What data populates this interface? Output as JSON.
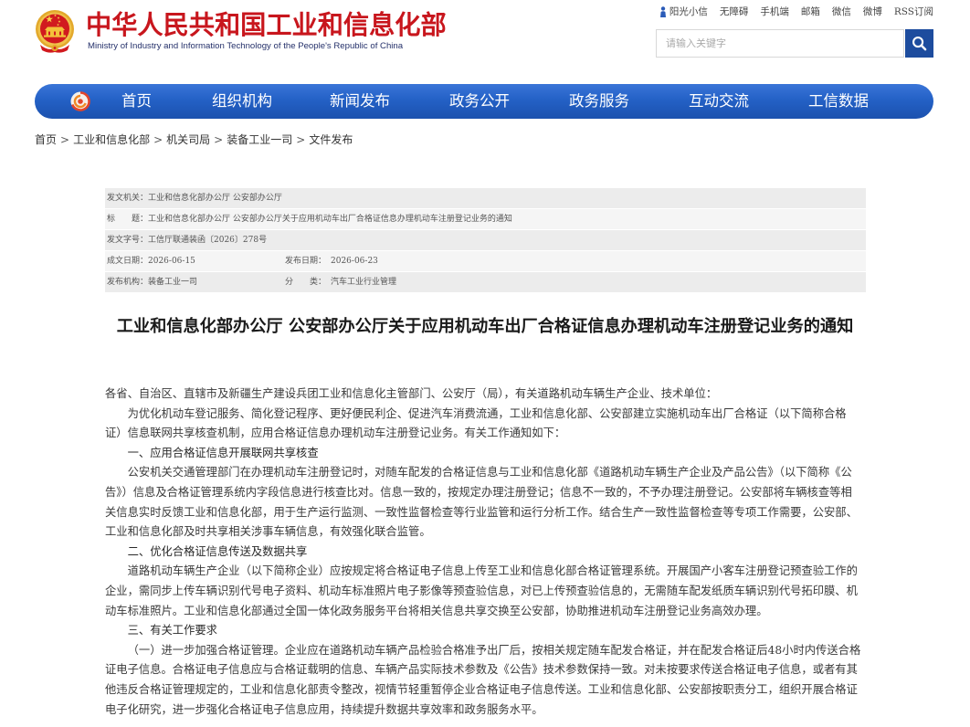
{
  "header": {
    "title_cn": "中华人民共和国工业和信息化部",
    "title_en": "Ministry of Industry and Information Technology of the People's Republic of China"
  },
  "icons": {
    "emblem": "national-emblem-icon",
    "nav_logo": "miit-logo-icon",
    "sunshine": "person-icon",
    "search": "search-icon"
  },
  "colors": {
    "brand_red": "#c8161d",
    "nav_blue": "#2461c6",
    "search_button_blue": "#1d4c9e"
  },
  "top_links": [
    "阳光小信",
    "无障碍",
    "手机端",
    "邮箱",
    "微信",
    "微博",
    "RSS订阅"
  ],
  "search": {
    "placeholder": "请输入关键字",
    "value": ""
  },
  "nav": {
    "items": [
      "首页",
      "组织机构",
      "新闻发布",
      "政务公开",
      "政务服务",
      "互动交流",
      "工信数据"
    ]
  },
  "breadcrumb": {
    "separator": ">",
    "items": [
      "首页",
      "工业和信息化部",
      "机关司局",
      "装备工业一司",
      "文件发布"
    ]
  },
  "meta": {
    "issuer": {
      "label": "发文机关：",
      "value": "工业和信息化部办公厅 公安部办公厅"
    },
    "title": {
      "label": "标　　题：",
      "value": "工业和信息化部办公厅 公安部办公厅关于应用机动车出厂合格证信息办理机动车注册登记业务的通知"
    },
    "doc_number": {
      "label": "发文字号：",
      "value": "工信厅联通装函〔2026〕278号"
    },
    "written_date": {
      "label": "成文日期：",
      "value": "2026-06-15"
    },
    "publish_date": {
      "label": "发布日期：",
      "value": "2026-06-23"
    },
    "publisher": {
      "label": "发布机构：",
      "value": "装备工业一司"
    },
    "category": {
      "label": "分　　类：",
      "value": "汽车工业行业管理"
    }
  },
  "article": {
    "title": "工业和信息化部办公厅 公安部办公厅关于应用机动车出厂合格证信息办理机动车注册登记业务的通知",
    "lines": [
      "各省、自治区、直辖市及新疆生产建设兵团工业和信息化主管部门、公安厅（局），有关道路机动车辆生产企业、技术单位：",
      "为优化机动车登记服务、简化登记程序、更好便民利企、促进汽车消费流通，工业和信息化部、公安部建立实施机动车出厂合格证（以下简称合格",
      "证）信息联网共享核查机制，应用合格证信息办理机动车注册登记业务。有关工作通知如下：",
      "一、应用合格证信息开展联网共享核查",
      "公安机关交通管理部门在办理机动车注册登记时，对随车配发的合格证信息与工业和信息化部《道路机动车辆生产企业及产品公告》（以下简称《公",
      "告》）信息及合格证管理系统内字段信息进行核查比对。信息一致的，按规定办理注册登记；信息不一致的，不予办理注册登记。公安部将车辆核查等相",
      "关信息实时反馈工业和信息化部，用于生产运行监测、一致性监督检查等行业监管和运行分析工作。结合生产一致性监督检查等专项工作需要，公安部、",
      "工业和信息化部及时共享相关涉事车辆信息，有效强化联合监管。",
      "二、优化合格证信息传送及数据共享",
      "道路机动车辆生产企业（以下简称企业）应按规定将合格证电子信息上传至工业和信息化部合格证管理系统。开展国产小客车注册登记预查验工作的",
      "企业，需同步上传车辆识别代号电子资料、机动车标准照片电子影像等预查验信息，对已上传预查验信息的，无需随车配发纸质车辆识别代号拓印膜、机",
      "动车标准照片。工业和信息化部通过全国一体化政务服务平台将相关信息共享交换至公安部，协助推进机动车注册登记业务高效办理。",
      "三、有关工作要求",
      "（一）进一步加强合格证管理。企业应在道路机动车辆产品检验合格准予出厂后，按相关规定随车配发合格证，并在配发合格证后48小时内传送合格",
      "证电子信息。合格证电子信息应与合格证载明的信息、车辆产品实际技术参数及《公告》技术参数保持一致。对未按要求传送合格证电子信息，或者有其",
      "他违反合格证管理规定的，工业和信息化部责令整改，视情节轻重暂停企业合格证电子信息传送。工业和信息化部、公安部按职责分工，组织开展合格证",
      "电子化研究，进一步强化合格证电子信息应用，持续提升数据共享效率和政务服务水平。"
    ]
  }
}
